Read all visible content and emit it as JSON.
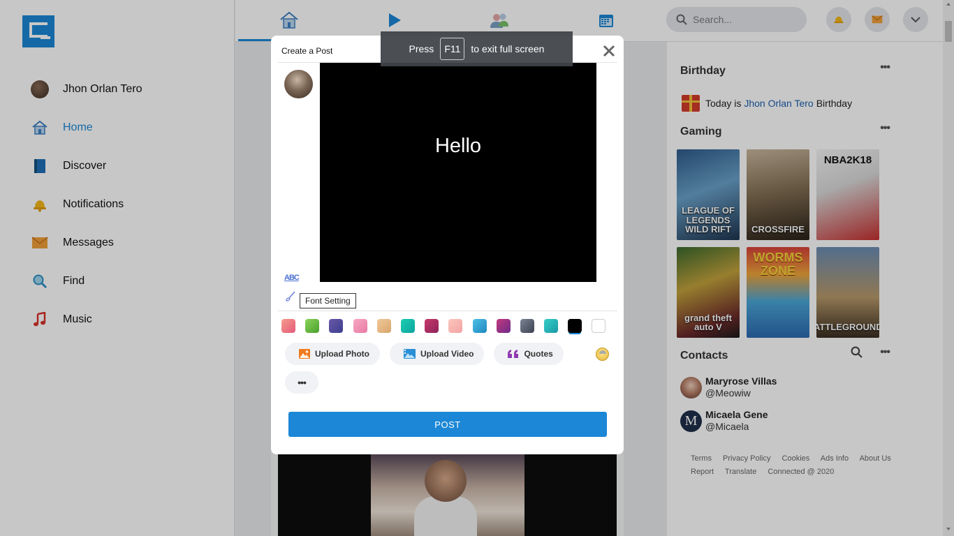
{
  "sidebar": {
    "items": [
      {
        "label": "Jhon Orlan Tero",
        "icon": "user-avatar"
      },
      {
        "label": "Home",
        "icon": "home-icon"
      },
      {
        "label": "Discover",
        "icon": "book-icon"
      },
      {
        "label": "Notifications",
        "icon": "bell-icon"
      },
      {
        "label": "Messages",
        "icon": "envelope-icon"
      },
      {
        "label": "Find",
        "icon": "magnifier-icon"
      },
      {
        "label": "Music",
        "icon": "music-note-icon"
      }
    ],
    "active": "Home"
  },
  "topbar": {
    "tabs": [
      "home-tab",
      "watch-tab",
      "friends-tab",
      "calendar-tab"
    ],
    "search_placeholder": "Search..."
  },
  "right": {
    "birthday": {
      "title": "Birthday",
      "prefix": "Today is",
      "name": "Jhon Orlan Tero",
      "suffix": "Birthday"
    },
    "gaming": {
      "title": "Gaming",
      "games": [
        "LEAGUE OF LEGENDS WILD RIFT",
        "CROSSFIRE",
        "NBA2K18",
        "grand theft auto V",
        "WORMS ZONE",
        "BATTLEGROUNDS"
      ]
    },
    "contacts": {
      "title": "Contacts",
      "list": [
        {
          "name": "Maryrose Villas",
          "handle": "@Meowiw"
        },
        {
          "name": "Micaela Gene",
          "handle": "@Micaela",
          "initial": "M"
        }
      ]
    },
    "footer": {
      "line1": [
        "Terms",
        "Privacy Policy",
        "Cookies",
        "Ads Info",
        "About Us"
      ],
      "line2": [
        "Report",
        "Translate",
        "Connected @ 2020"
      ]
    }
  },
  "modal": {
    "title": "Create a Post",
    "canvas_text": "Hello",
    "tool_text_icon": "ABC",
    "tooltip": "Font Setting",
    "swatches": [
      "#f08080",
      "#6cc04a",
      "#5b4a9b",
      "#f48fb1",
      "#e4b780",
      "#16b7a6",
      "#b72f6b",
      "#f8b7b7",
      "#2f9ed6",
      "#a12f7a",
      "#5b6170",
      "#2fb8b8",
      "#000000",
      "#ffffff"
    ],
    "selected_swatch": "#000000",
    "actions": {
      "upload_photo": "Upload Photo",
      "upload_video": "Upload Video",
      "quotes": "Quotes"
    },
    "post_label": "POST"
  },
  "fullscreen": {
    "press": "Press",
    "key": "F11",
    "rest": "to exit full screen"
  },
  "colors": {
    "accent": "#1b87d6"
  }
}
